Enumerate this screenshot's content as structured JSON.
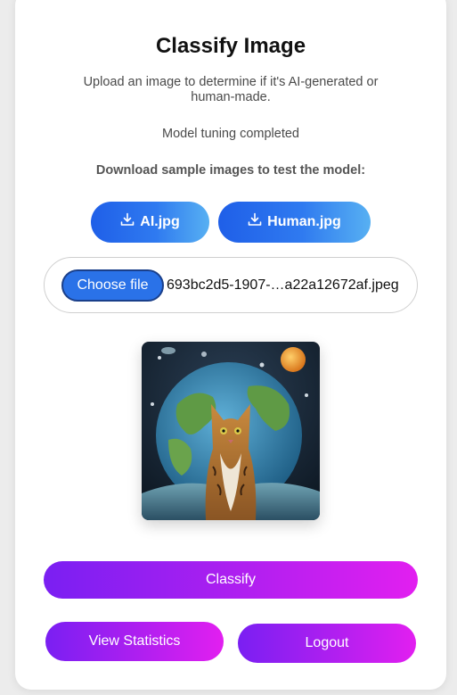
{
  "header": {
    "title": "Classify Image",
    "subtitle": "Upload an image to determine if it's AI-generated or human-made.",
    "status": "Model tuning completed"
  },
  "samples": {
    "heading": "Download sample images to test the model:",
    "ai_label": "AI.jpg",
    "human_label": "Human.jpg",
    "icon": "download-icon"
  },
  "upload": {
    "choose_label": "Choose file",
    "file_name": "693bc2d5-1907-…a22a12672af.jpeg"
  },
  "actions": {
    "classify_label": "Classify",
    "stats_label": "View Statistics",
    "logout_label": "Logout"
  },
  "colors": {
    "download_gradient": [
      "#1f5fe8",
      "#57b0f2"
    ],
    "action_gradient": [
      "#7a1ff2",
      "#e21ff0"
    ]
  }
}
